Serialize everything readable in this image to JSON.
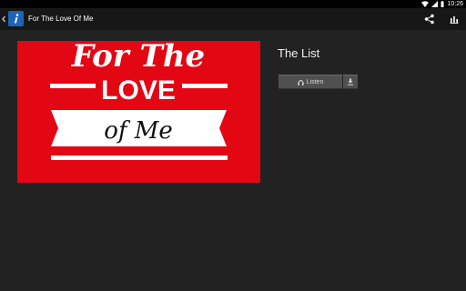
{
  "status_bar": {
    "time": "10:26"
  },
  "action_bar": {
    "title": "For The Love Of Me"
  },
  "cover": {
    "line1": "For The",
    "line2": "LOVE",
    "line3": "of Me",
    "background_color": "#e30613"
  },
  "show": {
    "title": "The List"
  },
  "controls": {
    "listen_label": "Listen"
  },
  "colors": {
    "accent": "#e30613",
    "app_icon": "#1c64b8"
  }
}
